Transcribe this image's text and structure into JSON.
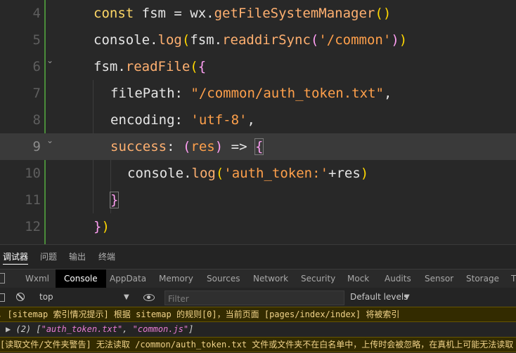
{
  "editor": {
    "lines": [
      {
        "number": "4",
        "tokens": [
          [
            "t-kw",
            "const"
          ],
          [
            "t-plain",
            " fsm = wx."
          ],
          [
            "t-meth",
            "getFileSystemManager"
          ],
          [
            "t-paren",
            "()"
          ]
        ]
      },
      {
        "number": "5",
        "tokens": [
          [
            "t-plain",
            "console."
          ],
          [
            "t-meth",
            "log"
          ],
          [
            "t-paren",
            "("
          ],
          [
            "t-plain",
            "fsm."
          ],
          [
            "t-meth",
            "readdirSync"
          ],
          [
            "t-brace",
            "("
          ],
          [
            "t-str",
            "'/common'"
          ],
          [
            "t-brace",
            ")"
          ],
          [
            "t-paren",
            ")"
          ]
        ]
      },
      {
        "number": "6",
        "tokens": [
          [
            "t-plain",
            "fsm."
          ],
          [
            "t-meth",
            "readFile"
          ],
          [
            "t-paren",
            "("
          ],
          [
            "t-brace",
            "{"
          ]
        ]
      },
      {
        "number": "7",
        "tokens": [
          [
            "t-key",
            "filePath"
          ],
          [
            "t-sep",
            ": "
          ],
          [
            "t-str",
            "\"/common/auth_token.txt\""
          ],
          [
            "t-sep",
            ","
          ]
        ]
      },
      {
        "number": "8",
        "tokens": [
          [
            "t-key",
            "encoding"
          ],
          [
            "t-sep",
            ": "
          ],
          [
            "t-str",
            "'utf-8'"
          ],
          [
            "t-sep",
            ","
          ]
        ]
      },
      {
        "number": "9",
        "tokens": [
          [
            "t-meth",
            "success"
          ],
          [
            "t-sep",
            ": "
          ],
          [
            "t-brace",
            "("
          ],
          [
            "t-param",
            "res"
          ],
          [
            "t-brace",
            ")"
          ],
          [
            "t-sep",
            " => "
          ],
          [
            "t-brace",
            "{"
          ]
        ]
      },
      {
        "number": "10",
        "tokens": [
          [
            "t-plain",
            "console."
          ],
          [
            "t-meth",
            "log"
          ],
          [
            "t-paren",
            "("
          ],
          [
            "t-str",
            "'auth_token:'"
          ],
          [
            "t-plain",
            "+res"
          ],
          [
            "t-paren",
            ")"
          ]
        ]
      },
      {
        "number": "11",
        "tokens": [
          [
            "t-brace",
            "}"
          ]
        ]
      },
      {
        "number": "12",
        "tokens": [
          [
            "t-brace",
            "}"
          ],
          [
            "t-paren",
            ")"
          ]
        ]
      }
    ],
    "fold_icon": "chevron-down-icon"
  },
  "devtools": {
    "panel_tabs": [
      "调试器",
      "问题",
      "输出",
      "终端"
    ],
    "tool_tabs": [
      "Wxml",
      "Console",
      "AppData",
      "Memory",
      "Sources",
      "Network",
      "Security",
      "Mock",
      "Audits",
      "Sensor",
      "Storage",
      "T"
    ],
    "active_tool_tab": "Console",
    "toolbar": {
      "context": "top",
      "filter_placeholder": "Filter",
      "levels": "Default levels"
    },
    "logs": [
      {
        "type": "warn",
        "text": "[sitemap 索引情况提示] 根据 sitemap 的规则[0]，当前页面 [pages/index/index] 将被索引"
      },
      {
        "type": "info",
        "prefix": "(2) [",
        "items": [
          "\"auth_token.txt\"",
          "\"common.js\""
        ],
        "suffix": "]"
      },
      {
        "type": "warn",
        "text": "[读取文件/文件夹警告] 无法读取 /common/auth_token.txt 文件或文件夹不在白名单中，上传时会被忽略，在真机上可能无法读取"
      }
    ]
  },
  "colors": {
    "editor_bg": "#282828",
    "keyword": "#ffd866",
    "string": "#ffa04b",
    "warning_bg": "#332b00"
  }
}
